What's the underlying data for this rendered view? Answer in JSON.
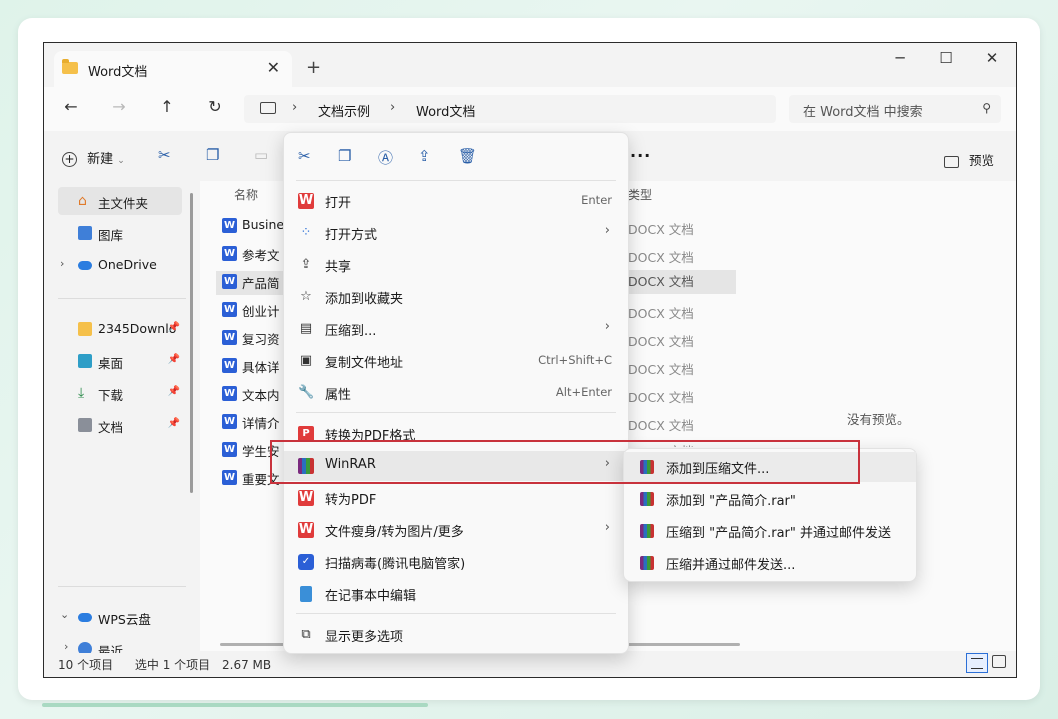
{
  "window": {
    "tab_title": "Word文档",
    "tab_close": "✕",
    "new_tab": "+",
    "minimize": "─",
    "maximize": "☐",
    "close": "✕"
  },
  "nav": {
    "back": "←",
    "forward": "→",
    "up": "↑",
    "refresh": "↻",
    "breadcrumb": [
      "文档示例",
      "Word文档"
    ],
    "search_placeholder": "在 Word文档 中搜索"
  },
  "toolbar": {
    "new_label": "新建",
    "more": "···",
    "preview_label": "预览"
  },
  "sidebar": {
    "items": [
      {
        "label": "主文件夹",
        "icon": "home-icon"
      },
      {
        "label": "图库",
        "icon": "gallery-icon"
      },
      {
        "label": "OneDrive",
        "icon": "cloud-icon"
      },
      {
        "label": "2345Downlo",
        "icon": "folder-icon"
      },
      {
        "label": "桌面",
        "icon": "desktop-icon"
      },
      {
        "label": "下载",
        "icon": "download-icon"
      },
      {
        "label": "文档",
        "icon": "document-icon"
      },
      {
        "label": "WPS云盘",
        "icon": "cloud-icon"
      },
      {
        "label": "最近",
        "icon": "clock-icon"
      }
    ]
  },
  "files": {
    "column_name": "名称",
    "column_type": "类型",
    "names": [
      "Busine",
      "参考文",
      "产品简",
      "创业计",
      "复习资",
      "具体详",
      "文本内",
      "详情介",
      "学生安",
      "重要文"
    ],
    "types": [
      "DOCX 文档",
      "DOCX 文档",
      "DOCX 文档",
      "DOCX 文档",
      "DOCX 文档",
      "DOCX 文档",
      "DOCX 文档",
      "DOCX 文档",
      "DOCX 文档"
    ],
    "no_preview": "没有预览。"
  },
  "context_menu": {
    "items": [
      {
        "label": "打开",
        "shortcut": "Enter",
        "icon": "wps-icon"
      },
      {
        "label": "打开方式",
        "icon": "apps-icon",
        "submenu": true
      },
      {
        "label": "共享",
        "icon": "share-icon"
      },
      {
        "label": "添加到收藏夹",
        "icon": "star-icon"
      },
      {
        "label": "压缩到...",
        "icon": "zip-icon",
        "submenu": true
      },
      {
        "label": "复制文件地址",
        "shortcut": "Ctrl+Shift+C",
        "icon": "copy-path-icon"
      },
      {
        "label": "属性",
        "shortcut": "Alt+Enter",
        "icon": "wrench-icon"
      },
      {
        "label": "转换为PDF格式",
        "icon": "pdf-icon"
      },
      {
        "label": "WinRAR",
        "icon": "winrar-icon",
        "submenu": true
      },
      {
        "label": "转为PDF",
        "icon": "wps-icon"
      },
      {
        "label": "文件瘦身/转为图片/更多",
        "icon": "wps-icon",
        "submenu": true
      },
      {
        "label": "扫描病毒(腾讯电脑管家)",
        "icon": "shield-icon"
      },
      {
        "label": "在记事本中编辑",
        "icon": "notepad-icon"
      },
      {
        "label": "显示更多选项",
        "icon": "more-options-icon"
      }
    ]
  },
  "submenu": {
    "items": [
      {
        "label": "添加到压缩文件..."
      },
      {
        "label": "添加到 \"产品简介.rar\""
      },
      {
        "label": "压缩到 \"产品简介.rar\" 并通过邮件发送"
      },
      {
        "label": "压缩并通过邮件发送..."
      }
    ]
  },
  "status": {
    "count": "10 个项目",
    "selected": "选中 1 个项目",
    "size": "2.67 MB"
  }
}
